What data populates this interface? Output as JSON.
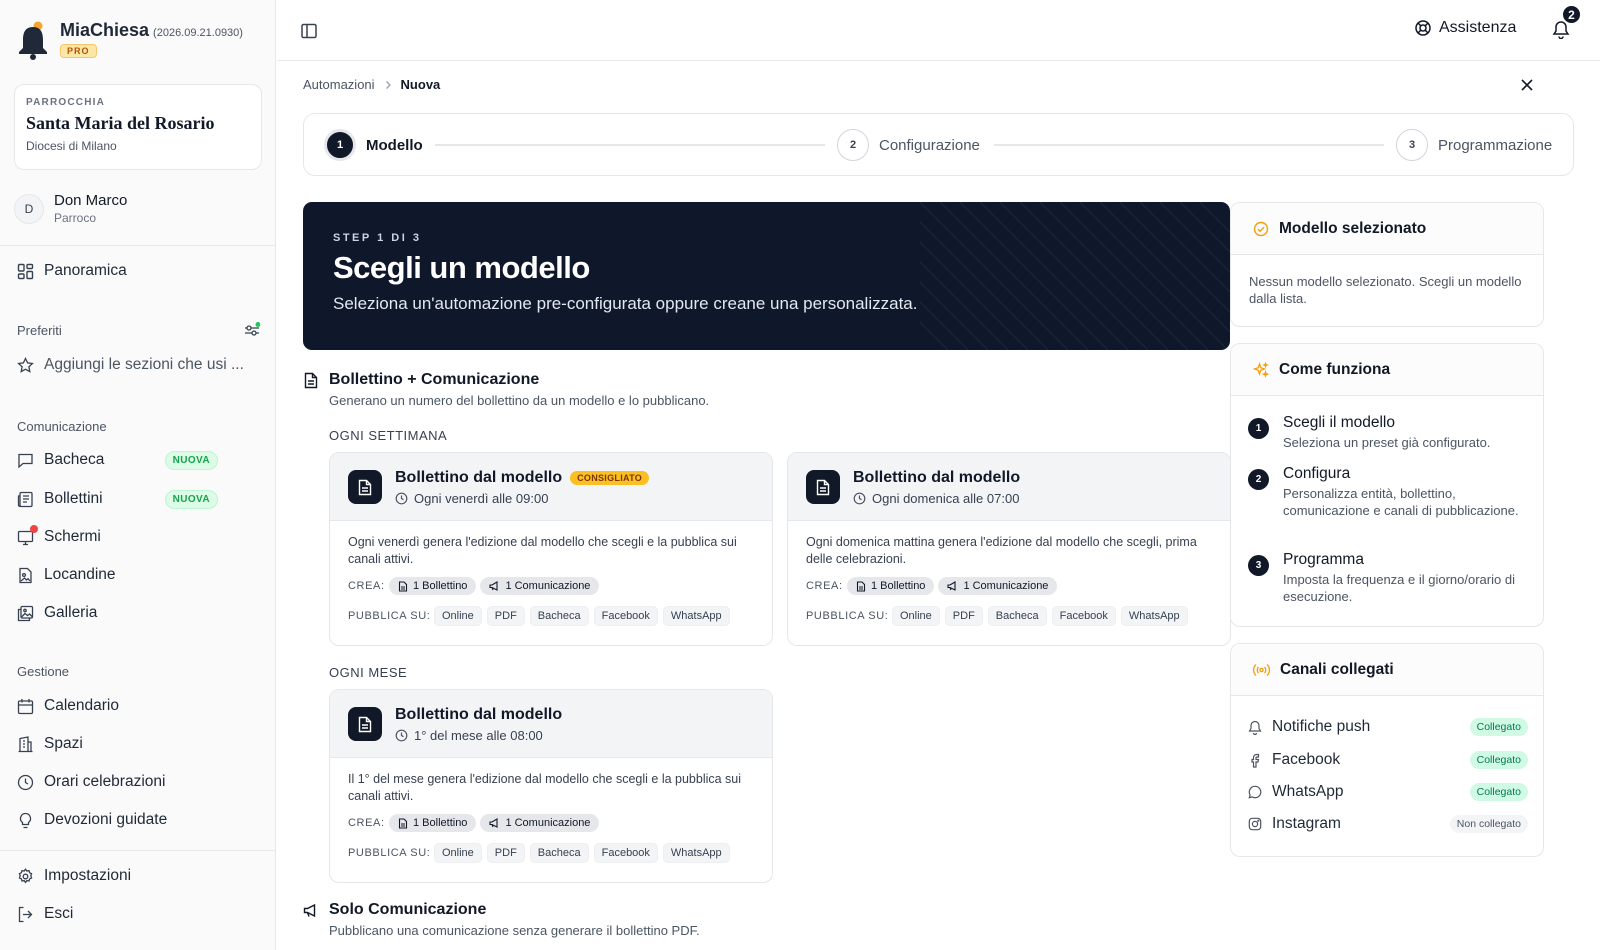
{
  "app": {
    "name": "MiaChiesa",
    "version": "(2026.09.21.0930)",
    "plan": "PRO"
  },
  "parish": {
    "tag": "PARROCCHIA",
    "name": "Santa Maria del Rosario",
    "diocese": "Diocesi di Milano"
  },
  "user": {
    "initial": "D",
    "name": "Don Marco",
    "role": "Parroco"
  },
  "nav": {
    "overview": "Panoramica",
    "favorites_title": "Preferiti",
    "favorites_add": "Aggiungi le sezioni che usi ...",
    "comm_title": "Comunicazione",
    "comm_items": [
      {
        "label": "Bacheca",
        "badge": "NUOVA"
      },
      {
        "label": "Bollettini",
        "badge": "NUOVA"
      },
      {
        "label": "Schermi"
      },
      {
        "label": "Locandine"
      },
      {
        "label": "Galleria"
      }
    ],
    "mgmt_title": "Gestione",
    "mgmt_items": [
      {
        "label": "Calendario"
      },
      {
        "label": "Spazi"
      },
      {
        "label": "Orari celebrazioni"
      },
      {
        "label": "Devozioni guidate"
      }
    ],
    "settings": "Impostazioni",
    "logout": "Esci"
  },
  "topbar": {
    "help": "Assistenza",
    "notifications": "2"
  },
  "breadcrumb": {
    "parent": "Automazioni",
    "current": "Nuova"
  },
  "stepper": [
    {
      "num": "1",
      "label": "Modello",
      "active": true
    },
    {
      "num": "2",
      "label": "Configurazione"
    },
    {
      "num": "3",
      "label": "Programmazione"
    }
  ],
  "hero": {
    "kicker": "STEP 1 DI 3",
    "title": "Scegli un modello",
    "subtitle": "Seleziona un'automazione pre-configurata oppure creane una personalizzata."
  },
  "group1": {
    "title": "Bollettino + Comunicazione",
    "desc": "Generano un numero del bollettino da un modello e lo pubblicano.",
    "weekly_label": "OGNI SETTIMANA",
    "monthly_label": "OGNI MESE"
  },
  "labels": {
    "crea": "CREA:",
    "pubblica": "PUBBLICA SU:"
  },
  "cards": [
    {
      "title": "Bollettino dal modello",
      "badge": "CONSIGLIATO",
      "time": "Ogni venerdì alle 09:00",
      "desc": "Ogni venerdì genera l'edizione dal modello che scegli e la pubblica sui canali attivi.",
      "chip1": "1 Bollettino",
      "chip2": "1 Comunicazione",
      "pubs": [
        "Online",
        "PDF",
        "Bacheca",
        "Facebook",
        "WhatsApp"
      ]
    },
    {
      "title": "Bollettino dal modello",
      "time": "Ogni domenica alle 07:00",
      "desc": "Ogni domenica mattina genera l'edizione dal modello che scegli, prima delle celebrazioni.",
      "chip1": "1 Bollettino",
      "chip2": "1 Comunicazione",
      "pubs": [
        "Online",
        "PDF",
        "Bacheca",
        "Facebook",
        "WhatsApp"
      ]
    },
    {
      "title": "Bollettino dal modello",
      "time": "1° del mese alle 08:00",
      "desc": "Il 1° del mese genera l'edizione dal modello che scegli e la pubblica sui canali attivi.",
      "chip1": "1 Bollettino",
      "chip2": "1 Comunicazione",
      "pubs": [
        "Online",
        "PDF",
        "Bacheca",
        "Facebook",
        "WhatsApp"
      ]
    }
  ],
  "group2": {
    "title": "Solo Comunicazione",
    "desc": "Pubblicano una comunicazione senza generare il bollettino PDF."
  },
  "selected": {
    "title": "Modello selezionato",
    "body": "Nessun modello selezionato. Scegli un modello dalla lista."
  },
  "how": {
    "title": "Come funziona",
    "steps": [
      {
        "num": "1",
        "title": "Scegli il modello",
        "desc": "Seleziona un preset già configurato."
      },
      {
        "num": "2",
        "title": "Configura",
        "desc": "Personalizza entità, bollettino, comunicazione e canali di pubblicazione."
      },
      {
        "num": "3",
        "title": "Programma",
        "desc": "Imposta la frequenza e il giorno/orario di esecuzione."
      }
    ]
  },
  "channels": {
    "title": "Canali collegati",
    "items": [
      {
        "name": "Notifiche push",
        "status": "Collegato"
      },
      {
        "name": "Facebook",
        "status": "Collegato"
      },
      {
        "name": "WhatsApp",
        "status": "Collegato"
      },
      {
        "name": "Instagram",
        "status": "Non collegato"
      }
    ]
  },
  "colors": {
    "dark": "#0f172a",
    "accent_green": "#16a34a",
    "badge_amber": "#fbbf24",
    "notif_dot": "#ef4444"
  }
}
